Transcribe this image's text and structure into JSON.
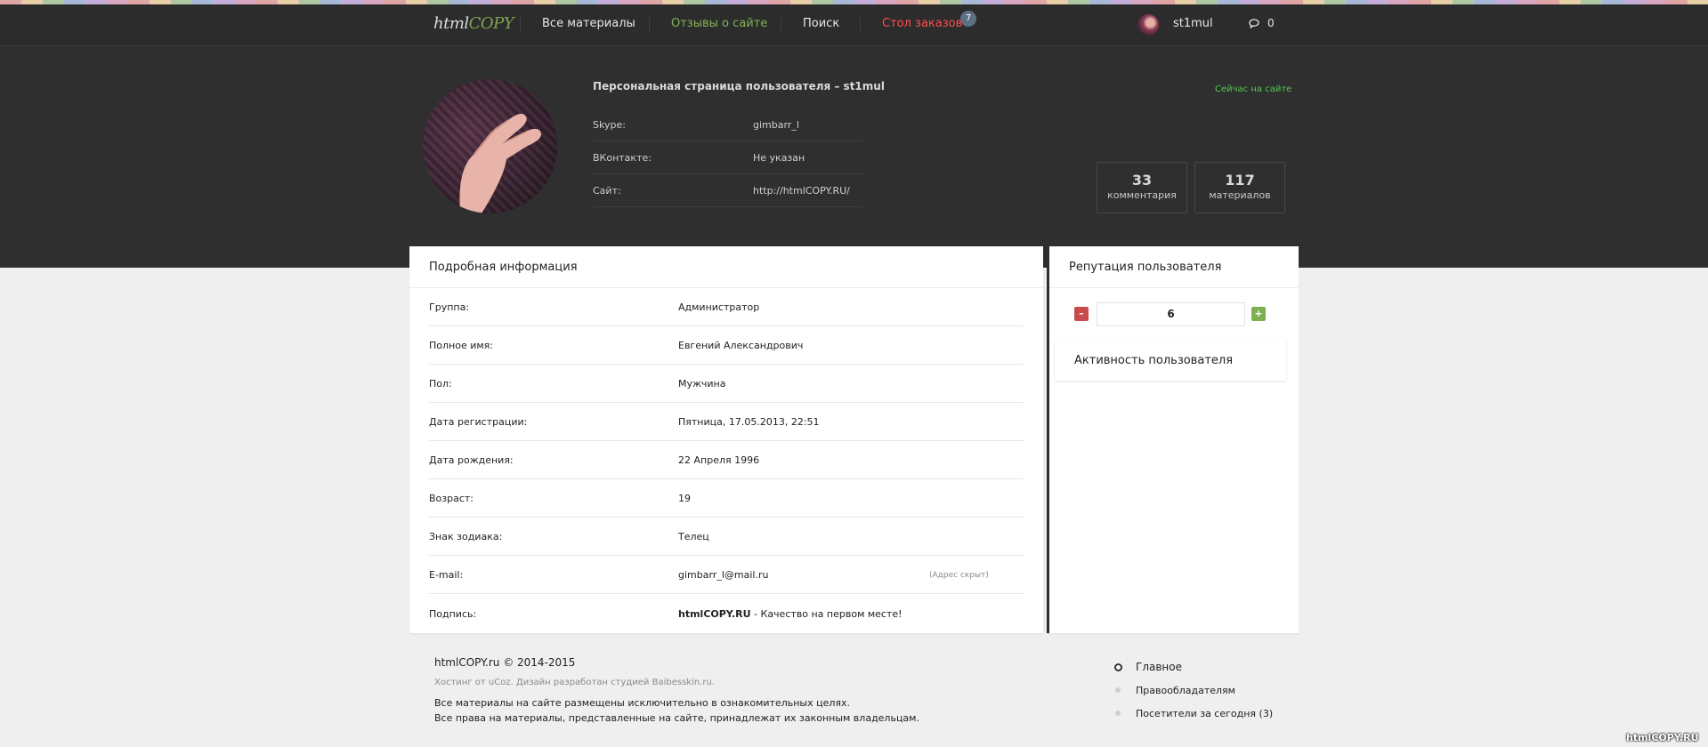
{
  "header": {
    "logo_left": "html",
    "logo_right": "COPY",
    "nav": {
      "all_materials": "Все материалы",
      "reviews": "Отзывы о сайте",
      "search": "Поиск",
      "orders": "Стол заказов",
      "orders_badge": "7"
    },
    "user": {
      "name": "st1mul",
      "messages": "0"
    }
  },
  "profile": {
    "title": "Персональная страница пользователя – st1mul",
    "online": "Сейчас на сайте",
    "fields": [
      {
        "label": "Skype:",
        "value": "gimbarr_l"
      },
      {
        "label": "ВКонтакте:",
        "value": "Не указан"
      },
      {
        "label": "Сайт:",
        "value": "http://htmlCOPY.RU/"
      }
    ],
    "stats": [
      {
        "number": "33",
        "caption": "комментария"
      },
      {
        "number": "117",
        "caption": "материалов"
      }
    ]
  },
  "details": {
    "heading": "Подробная информация",
    "rows": [
      {
        "label": "Группа:",
        "value": "Администратор"
      },
      {
        "label": "Полное имя:",
        "value": "Евгений Александрович"
      },
      {
        "label": "Пол:",
        "value": "Мужчина"
      },
      {
        "label": "Дата регистрации:",
        "value": "Пятница, 17.05.2013, 22:51"
      },
      {
        "label": "Дата рождения:",
        "value": "22 Апреля 1996"
      },
      {
        "label": "Возраст:",
        "value": "19"
      },
      {
        "label": "Знак зодиака:",
        "value": "Телец"
      },
      {
        "label": "E-mail:",
        "value": "gimbarr_l@mail.ru",
        "note": "(Адрес скрыт)"
      },
      {
        "label": "Подпись:",
        "brand": "htmlCOPY.RU",
        "value": " - Качество на первом месте!"
      }
    ]
  },
  "reputation": {
    "heading": "Репутация пользователя",
    "minus": "–",
    "plus": "+",
    "value": "6",
    "activity": "Активность пользователя"
  },
  "footer": {
    "copyright": "htmlCOPY.ru © 2014-2015",
    "hosting": "Хостинг от uCoz. Дизайн разработан студией Baibesskin.ru.",
    "line1": "Все материалы на сайте размещены исключительно в ознакомительных целях.",
    "line2": "Все права на материалы, представленные на сайте, принадлежат их законным владельцам.",
    "links": [
      "Главное",
      "Правообладателям",
      "Посетители за сегодня (3)"
    ],
    "watermark": "htmlCOPY.RU"
  },
  "colors": {
    "topbar": "#2c2c2c",
    "hero": "#2f2f2f",
    "accent_green": "#82b356",
    "orders_red": "#ff4d4d",
    "online_green": "#52c94e",
    "minus_red": "#c94b4b",
    "plus_green": "#7fb04f"
  },
  "icons": [
    "speech-bubble-icon",
    "home-circle-icon",
    "bullet-icon"
  ]
}
